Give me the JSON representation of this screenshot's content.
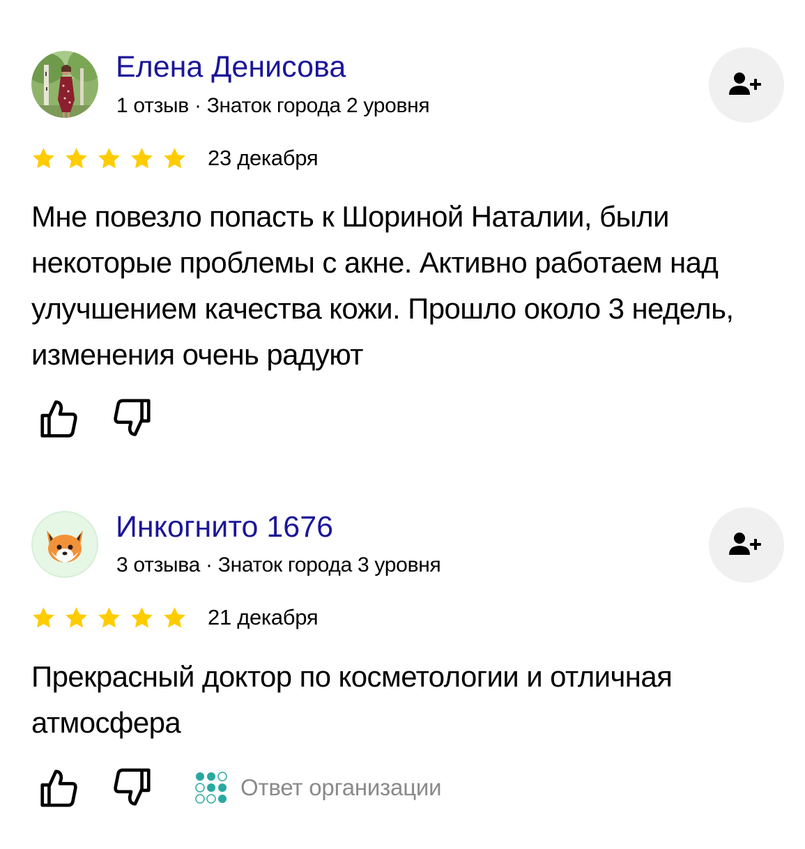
{
  "reviews": [
    {
      "author": "Елена Денисова",
      "meta": "1 отзыв · Знаток города 2 уровня",
      "rating": 5,
      "date": "23 декабря",
      "text": "Мне повезло попасть к Шориной Наталии, были некоторые проблемы с акне. Активно работаем над улучшением качества кожи. Прошло около 3 недель, изменения очень радуют",
      "avatar": "user-photo",
      "org_reply": ""
    },
    {
      "author": "Инкогнито 1676",
      "meta": "3 отзыва · Знаток города 3 уровня",
      "rating": 5,
      "date": "21 декабря",
      "text": "Прекрасный доктор по косметологии и отличная атмосфера",
      "avatar": "fox-emoji",
      "org_reply": "Ответ организации"
    }
  ],
  "icons": {
    "subscribe": "add-user-icon",
    "like": "thumbs-up-icon",
    "dislike": "thumbs-down-icon",
    "star": "star-icon"
  },
  "colors": {
    "author_name": "#1b1699",
    "star": "#ffcc00",
    "button_bg": "#f0f0f0",
    "muted_text": "#8a8a8a",
    "fox_avatar_bg": "#e6f7e6"
  }
}
